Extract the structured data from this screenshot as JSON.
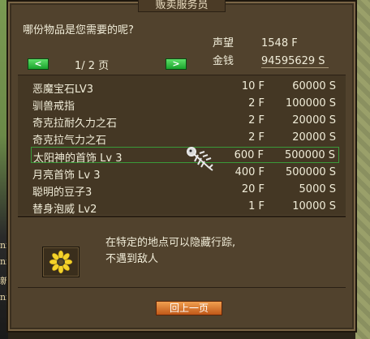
{
  "window": {
    "title": "贩卖服务员"
  },
  "header": {
    "question": "哪份物品是您需要的呢?",
    "prestige_label": "声望",
    "prestige_value": "1548 F",
    "money_label": "金钱",
    "money_value": "94595629 S",
    "page_indicator": "1/ 2 页"
  },
  "items": [
    {
      "name": "恶魔宝石LV3",
      "count": "10 F",
      "price": "60000 S"
    },
    {
      "name": "驯兽戒指",
      "count": "2 F",
      "price": "100000 S"
    },
    {
      "name": "奇克拉耐久力之石",
      "count": "2 F",
      "price": "20000 S"
    },
    {
      "name": "奇克拉气力之石",
      "count": "2 F",
      "price": "20000 S"
    },
    {
      "name": "太阳神的首饰 Lv 3",
      "count": "600 F",
      "price": "500000 S"
    },
    {
      "name": "月亮首饰 Lv 3",
      "count": "400 F",
      "price": "500000 S"
    },
    {
      "name": "聪明的豆子3",
      "count": "20 F",
      "price": "5000 S"
    },
    {
      "name": "替身泡威 Lv2",
      "count": "1 F",
      "price": "10000 S"
    }
  ],
  "description": {
    "line1": "在特定的地点可以隐藏行踪,",
    "line2": "不遇到敌人",
    "icon": "sunflower-icon"
  },
  "footer": {
    "back_label": "回上一页"
  },
  "icons": {
    "prev": "<",
    "next": ">"
  },
  "world": {
    "left_chars": [
      "ni",
      "ni",
      "新",
      "ni"
    ]
  },
  "colors": {
    "accent_green": "#1aa42c",
    "button_orange": "#d8702a",
    "selected_border": "#3a9a3a"
  }
}
